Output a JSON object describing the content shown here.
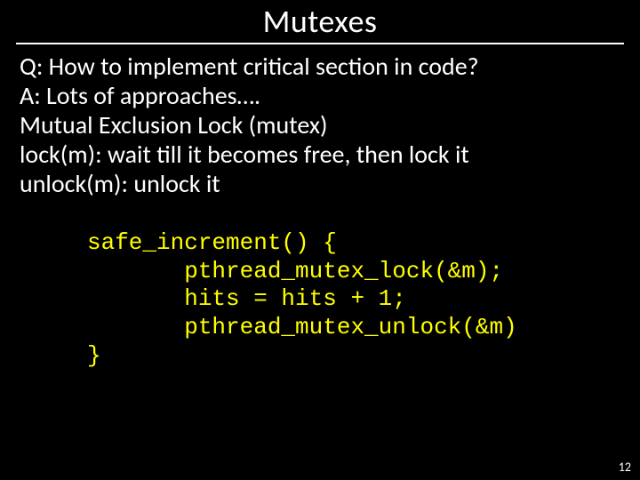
{
  "title": "Mutexes",
  "body": {
    "l1": "Q: How to implement critical section in code?",
    "l2": "A: Lots of approaches….",
    "l3": "Mutual Exclusion Lock (mutex)",
    "l4": "lock(m): wait till it becomes free, then lock it",
    "l5": "unlock(m): unlock it"
  },
  "code": "safe_increment() {\n       pthread_mutex_lock(&m);\n       hits = hits + 1;\n       pthread_mutex_unlock(&m)\n}",
  "pagenum": "12"
}
